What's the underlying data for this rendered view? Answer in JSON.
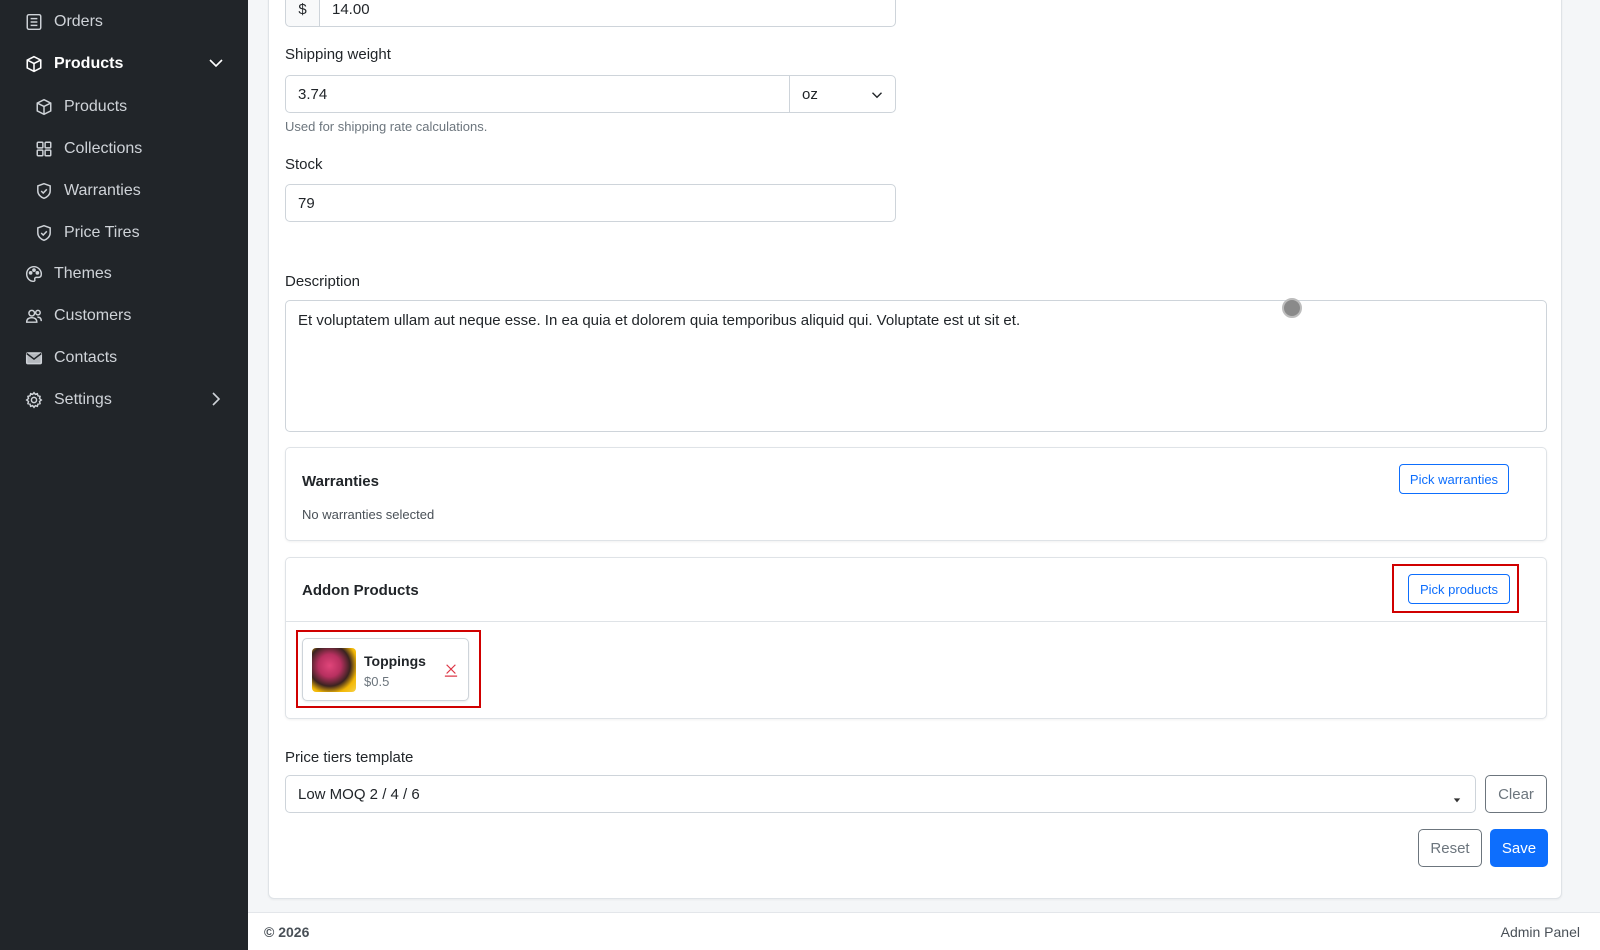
{
  "sidebar": {
    "items": [
      {
        "label": "Orders",
        "icon": "orders-icon"
      },
      {
        "label": "Products",
        "icon": "box-icon",
        "active": true,
        "expanded": true
      },
      {
        "label": "Products",
        "icon": "box-icon",
        "sub": true
      },
      {
        "label": "Collections",
        "icon": "grid-icon",
        "sub": true
      },
      {
        "label": "Warranties",
        "icon": "shield-icon",
        "sub": true
      },
      {
        "label": "Price Tires",
        "icon": "shield-icon",
        "sub": true
      },
      {
        "label": "Themes",
        "icon": "palette-icon"
      },
      {
        "label": "Customers",
        "icon": "users-icon"
      },
      {
        "label": "Contacts",
        "icon": "envelope-icon"
      },
      {
        "label": "Settings",
        "icon": "gear-icon",
        "has_children": true
      }
    ]
  },
  "form": {
    "price": {
      "prefix": "$",
      "value": "14.00"
    },
    "shipping_weight": {
      "label": "Shipping weight",
      "value": "3.74",
      "unit": "oz",
      "hint": "Used for shipping rate calculations."
    },
    "stock": {
      "label": "Stock",
      "value": "79"
    },
    "description": {
      "label": "Description",
      "value": "Et voluptatem ullam aut neque esse. In ea quia et dolorem quia temporibus aliquid qui. Voluptate est ut sit et."
    },
    "warranties": {
      "title": "Warranties",
      "button": "Pick warranties",
      "empty_text": "No warranties selected"
    },
    "addon_products": {
      "title": "Addon Products",
      "button": "Pick products",
      "items": [
        {
          "name": "Toppings",
          "price": "$0.5"
        }
      ]
    },
    "price_tiers": {
      "label": "Price tiers template",
      "value": "Low MOQ 2 / 4 / 6",
      "clear_label": "Clear"
    },
    "actions": {
      "reset": "Reset",
      "save": "Save"
    }
  },
  "footer": {
    "copyright": "© 2026",
    "app_name": "Admin Panel"
  },
  "colors": {
    "sidebar_bg": "#212529",
    "primary": "#0d6efd",
    "highlight": "#d00000"
  }
}
